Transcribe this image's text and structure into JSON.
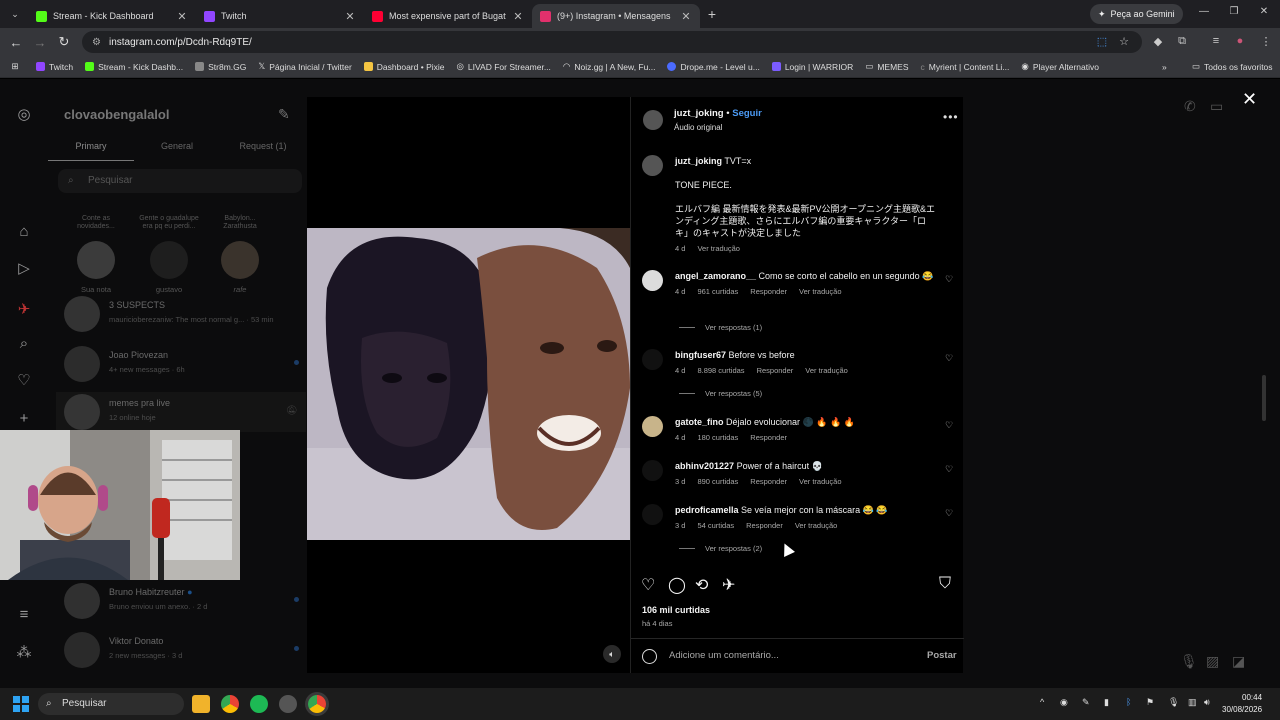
{
  "tabs": [
    {
      "title": "Stream - Kick Dashboard",
      "color": "#53fc18"
    },
    {
      "title": "Twitch",
      "color": "#9146ff"
    },
    {
      "title": "Most expensive part of Bugatti",
      "color": "#ff0033"
    },
    {
      "title": "(9+) Instagram • Mensagens",
      "color": "#e1306c"
    }
  ],
  "gemini_label": "Peça ao Gemini",
  "url": "instagram.com/p/Dcdn-Rdq9TE/",
  "bookmarks": [
    {
      "label": "Twitch",
      "color": "#9146ff"
    },
    {
      "label": "Stream - Kick Dashb...",
      "color": "#53fc18"
    },
    {
      "label": "Str8m.GG",
      "color": "#ffffff"
    },
    {
      "label": "Página Inicial / Twitter",
      "color": "#ffffff"
    },
    {
      "label": "Dashboard • Pixie",
      "color": "#f4c542"
    },
    {
      "label": "LIVAD For Streamer...",
      "color": "#dddddd"
    },
    {
      "label": "Noiz.gg | A New, Fu...",
      "color": "#cccccc"
    },
    {
      "label": "Drope.me - Level u...",
      "color": "#4b6bff"
    },
    {
      "label": "Login | WARRIOR",
      "color": "#7b5cff"
    },
    {
      "label": "MEMES",
      "color": "#aaaaaa"
    },
    {
      "label": "Myrient | Content Li...",
      "color": "#aaaaaa"
    },
    {
      "label": "Player Alternativo",
      "color": "#dddddd"
    }
  ],
  "bookmarks_folder": "Todos os favoritos",
  "dm": {
    "username": "clovaobengalalol",
    "tabs": [
      "Primary",
      "General",
      "Request (1)"
    ],
    "search_placeholder": "Pesquisar",
    "notes": [
      {
        "bubble": "Conte as novidades...",
        "name": "Sua nota"
      },
      {
        "bubble": "Gente o guadalupe era pq eu perdi...",
        "name": "gustavo"
      },
      {
        "bubble": "Babylon... Zarathusta",
        "name": "rafe"
      }
    ],
    "conversations": [
      {
        "name": "3 SUSPECTS",
        "sub": "mauricioberezaniw: The most normal g... · 53 min"
      },
      {
        "name": "Joao Piovezan",
        "sub": "4+ new messages · 6h"
      },
      {
        "name": "memes pra live",
        "sub": "12 online hoje"
      },
      {
        "name": "Bruno Habitzreuter",
        "sub": "Bruno enviou um anexo. · 2 d"
      },
      {
        "name": "Viktor Donato",
        "sub": "2 new messages · 3 d"
      }
    ]
  },
  "post": {
    "author": "juzt_joking",
    "follow": "Seguir",
    "audio": "Áudio original",
    "caption_line1": "TVT=x",
    "caption_line2": "TONE PIECE.",
    "caption_line3": "エルバフ編 最新情報を発表&最新PV公開オープニング主題歌&エンディング主題歌、さらにエルバフ編の重要キャラクター「ロキ」のキャストが決定しました",
    "caption_age": "4 d",
    "see_translation": "Ver tradução",
    "reply_label": "Responder",
    "comments": [
      {
        "user": "angel_zamorano__",
        "text": "Como se corto el cabello en un segundo 😂",
        "age": "4 d",
        "likes": "961 curtidas",
        "replies": "Ver respostas (1)"
      },
      {
        "user": "bingfuser67",
        "text": "Before vs before",
        "age": "4 d",
        "likes": "8.898 curtidas",
        "replies": "Ver respostas (5)"
      },
      {
        "user": "gatote_fino",
        "text": "Déjalo evolucionar 🌑 🔥 🔥 🔥",
        "age": "4 d",
        "likes": "180 curtidas",
        "replies": ""
      },
      {
        "user": "abhinv201227",
        "text": "Power of a haircut 💀",
        "age": "3 d",
        "likes": "890 curtidas",
        "replies": ""
      },
      {
        "user": "pedroficamella",
        "text": "Se veía mejor con la máscara 😂 😂",
        "age": "3 d",
        "likes": "54 curtidas",
        "replies": "Ver respostas (2)"
      }
    ],
    "total_likes": "106 mil curtidas",
    "posted": "há 4 dias",
    "add_comment_placeholder": "Adicione um comentário...",
    "post_button": "Postar"
  },
  "taskbar": {
    "search": "Pesquisar",
    "time": "00:44",
    "date": "30/08/2026"
  }
}
